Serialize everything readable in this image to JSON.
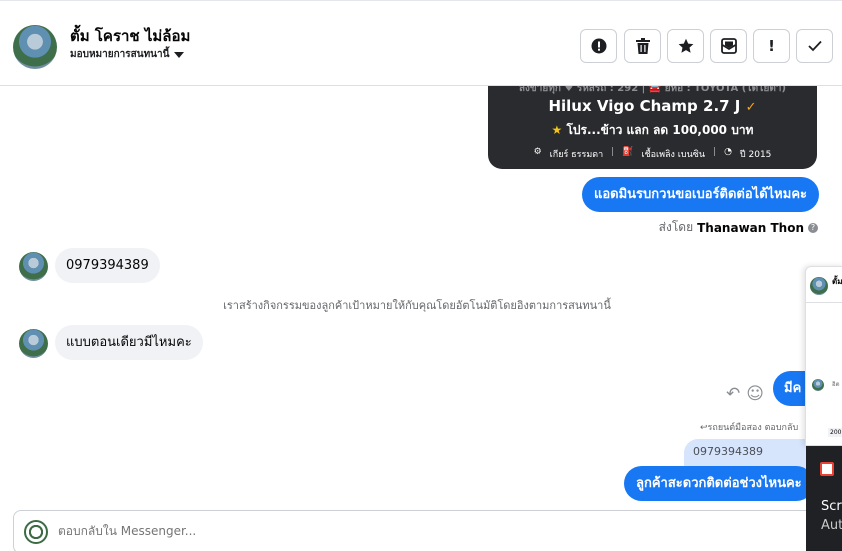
{
  "header": {
    "contact_name": "ตั้ม โคราช ไม่ล้อม",
    "assign_label": "มอบหมายการสนทนานี้",
    "actions": [
      {
        "icon": "alert-circle-icon",
        "glyph": "!"
      },
      {
        "icon": "trash-icon",
        "glyph": "🗑"
      },
      {
        "icon": "star-icon",
        "glyph": "★"
      },
      {
        "icon": "archive-mail-icon",
        "glyph": "✉"
      },
      {
        "icon": "exclamation-icon",
        "glyph": "!"
      },
      {
        "icon": "checkmark-icon",
        "glyph": "✓"
      }
    ]
  },
  "car_card": {
    "top_line": "ลงขายทุก ♥ รหัสรถ : 292 | 🚘 ยี่ห้อ : TOYOTA (โตโยต้า)",
    "model": "Hilux Vigo Champ 2.7 J",
    "promo": "โปร...ข้าว แลก ลด 100,000 บาท",
    "specs": [
      "เกียร์ ธรรมดา",
      "เชื้อเพลิง เบนซิน",
      "ปี 2015"
    ]
  },
  "messages": {
    "out_1": "แอดมินรบกวนขอเบอร์ติดต่อได้ไหมคะ",
    "sent_by_prefix": "ส่งโดย",
    "sent_by_name": "Thanawan Thon",
    "in_1": "0979394389",
    "system_note": "เราสร้างกิจกรรมของลูกค้าเป้าหมายให้กับคุณโดยอัตโนมัติโดยอิงตามการสนทนานี้",
    "in_2": "แบบตอนเดียวมีไหมคะ",
    "out_2_partial": "มีค",
    "reply_label": "รถยนต์มือสอง ตอบกลับ",
    "quoted": "0979394389",
    "out_3": "ลูกค้าสะดวกติดต่อช่วงไหนคะ"
  },
  "composer": {
    "placeholder": "ตอบกลับใน Messenger..."
  },
  "side_window": {
    "name": "ตั้ม",
    "small_text": "อิต",
    "pill": "200"
  },
  "dark_panel": {
    "line1": "Scre",
    "line2": "Aut"
  }
}
